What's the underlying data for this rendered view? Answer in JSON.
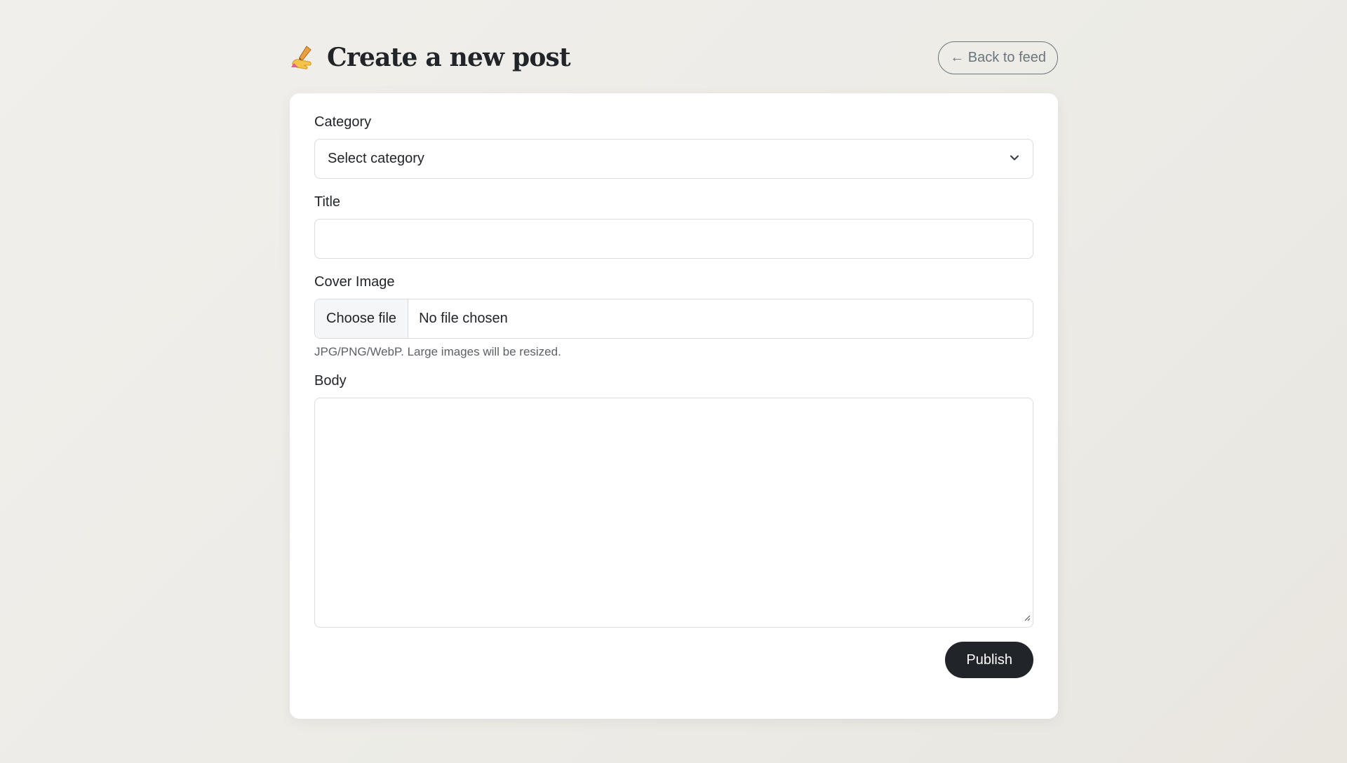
{
  "header": {
    "emoji_icon": "writing-hand-icon",
    "title": "Create a new post",
    "back_label": "← Back to feed"
  },
  "form": {
    "category": {
      "label": "Category",
      "selected": "Select category",
      "icon": "chevron-down-icon"
    },
    "title": {
      "label": "Title",
      "value": "",
      "placeholder": ""
    },
    "cover_image": {
      "label": "Cover Image",
      "button_label": "Choose file",
      "status": "No file chosen",
      "help": "JPG/PNG/WebP. Large images will be resized."
    },
    "body": {
      "label": "Body",
      "value": ""
    },
    "publish_label": "Publish"
  },
  "colors": {
    "accent": "#212529",
    "muted": "#6c757d",
    "border": "#d9dcdf",
    "card": "#ffffff"
  }
}
